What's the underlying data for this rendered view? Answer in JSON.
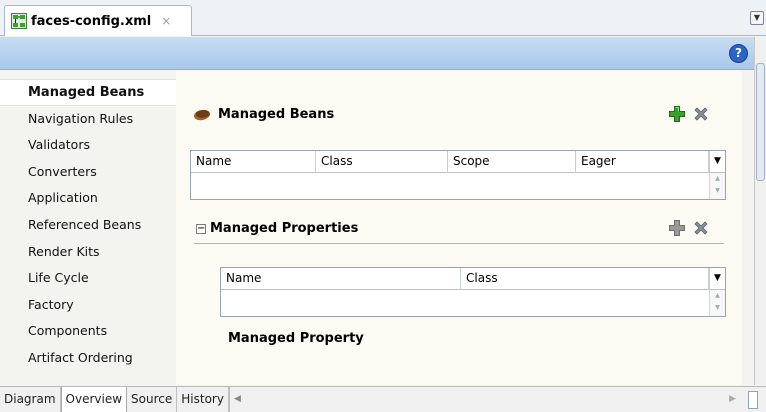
{
  "editor_tab": {
    "title": "faces-config.xml",
    "close_glyph": "×",
    "icon": "faces-config-file-icon"
  },
  "header": {
    "help_glyph": "?"
  },
  "leftnav": {
    "items": [
      {
        "label": "Managed Beans",
        "active": true
      },
      {
        "label": "Navigation Rules"
      },
      {
        "label": "Validators"
      },
      {
        "label": "Converters"
      },
      {
        "label": "Application"
      },
      {
        "label": "Referenced Beans"
      },
      {
        "label": "Render Kits"
      },
      {
        "label": "Life Cycle"
      },
      {
        "label": "Factory"
      },
      {
        "label": "Components"
      },
      {
        "label": "Artifact Ordering"
      }
    ]
  },
  "managed_beans": {
    "title": "Managed Beans",
    "columns": [
      "Name",
      "Class",
      "Scope",
      "Eager"
    ]
  },
  "managed_properties": {
    "collapse_glyph": "−",
    "title": "Managed Properties",
    "columns": [
      "Name",
      "Class"
    ],
    "detail_label": "Managed Property"
  },
  "bottom_tabs": [
    {
      "label": "Diagram"
    },
    {
      "label": "Overview",
      "active": true
    },
    {
      "label": "Source"
    },
    {
      "label": "History"
    }
  ],
  "colors": {
    "add_active": "#3aa12a",
    "add_disabled": "#9a9a9a",
    "delete": "#8a9099"
  }
}
